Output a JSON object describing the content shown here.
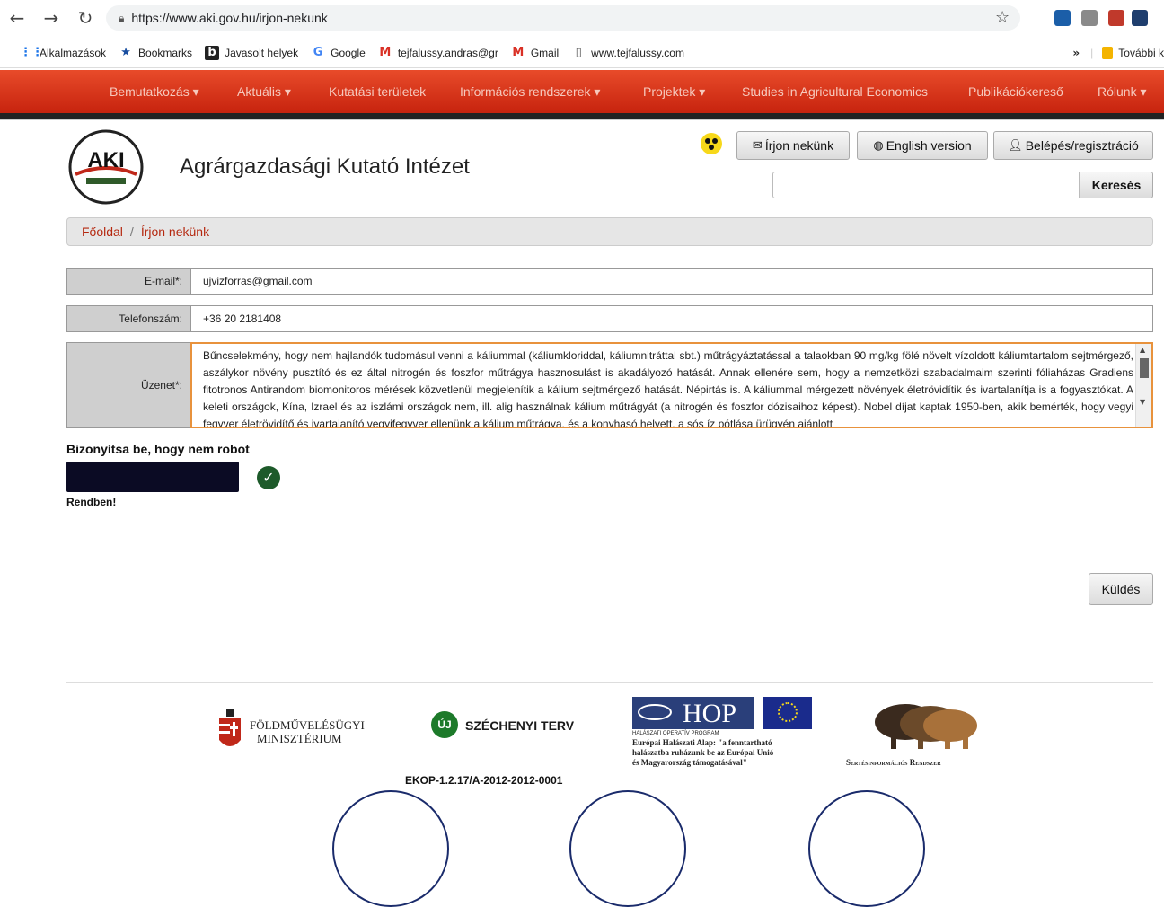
{
  "browser": {
    "url": "https://www.aki.gov.hu/irjon-nekunk",
    "bookmarks": [
      "Alkalmazások",
      "Bookmarks",
      "Javasolt helyek",
      "Google",
      "tejfalussy.andras@gr",
      "Gmail",
      "www.tejfalussy.com"
    ],
    "more_bookmarks": "További k"
  },
  "nav": {
    "items": [
      "Bemutatkozás",
      "Aktuális",
      "Kutatási területek",
      "Információs rendszerek",
      "Projektek",
      "Studies in Agricultural Economics",
      "Publikációkereső",
      "Rólunk"
    ]
  },
  "header": {
    "logo_text": "AKI",
    "title": "Agrárgazdasági Kutató Intézet",
    "btn_contact": "Írjon nekünk",
    "btn_english": "English version",
    "btn_login": "Belépés/regisztráció",
    "search_button": "Keresés",
    "search_value": ""
  },
  "breadcrumb": {
    "home": "Főoldal",
    "separator": "/",
    "current": "Írjon nekünk"
  },
  "form": {
    "email_label": "E-mail*:",
    "email_value": "ujvizforras@gmail.com",
    "phone_label": "Telefonszám:",
    "phone_value": "+36 20 2181408",
    "message_label": "Üzenet*:",
    "message_value": "Bűncselekmény, hogy nem hajlandók tudomásul venni a káliummal (káliumkloriddal, káliumnitráttal sbt.) műtrágyáztatással a talaokban 90 mg/kg fölé növelt vízoldott káliumtartalom sejtmérgező, aszálykor növény pusztító és ez által  nitrogén és foszfor műtrágya hasznosulást is akadályozó hatását. Annak ellenére sem, hogy a nemzetközi szabadalmaim szerinti fóliaházas Gradiens fitotronos Antirandom biomonitoros mérések közvetlenül megjelenítik a kálium sejtmérgező hatását. Népirtás is. A káliummal mérgezett növények életrövidítik és ivartalanítja is a fogyasztókat. A keleti országok, Kína,  Izrael és az iszlámi országok nem, ill. alig használnak kálium műtrágyát (a nitrogén és foszfor dózisaihoz képest). Nobel díjat kaptak 1950-ben, akik bemérték, hogy vegyi fegyver életrövidítő és ivartalanító vegyifegyver ellenünk a kálium műtrágya, és a konyhasó helyett, a sós íz pótlása ürügyén ajánlott",
    "robot_title": "Bizonyítsa be, hogy nem robot",
    "robot_status": "Rendben!",
    "submit": "Küldés"
  },
  "footer": {
    "ministry_line1": "FÖLDMŰVELÉSÜGYI",
    "ministry_line2": "MINISZTÉRIUM",
    "szechenyi_badge": "ÚJ",
    "szechenyi": "SZÉCHENYI TERV",
    "hop_logo": "HOP",
    "hop_sub": "HALÁSZATI OPERATÍV PROGRAM",
    "hop_text1": "Európai Halászati Alap: \"a fenntartható",
    "hop_text2": "halászatba ruházunk be az Európai Unió",
    "hop_text3": "és Magyarország támogatásával\"",
    "pig_system": "Sertésinformációs Rendszer",
    "ekop": "EKOP-1.2.17/A-2012-2012-0001"
  },
  "colors": {
    "nav_red": "#d0301a",
    "accent_link": "#b5280f",
    "message_border": "#e8923c",
    "captcha_box": "#0b0b24",
    "check_green": "#1d5a2a"
  }
}
